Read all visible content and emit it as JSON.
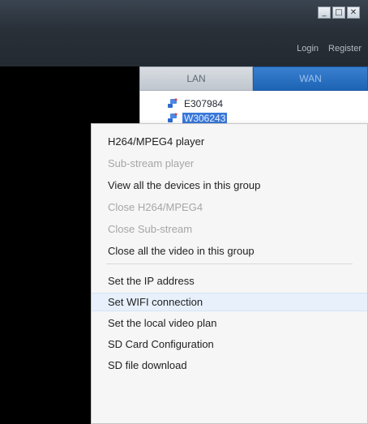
{
  "window": {
    "controls": {
      "minimize": "_",
      "restore": "□",
      "close": "✕"
    }
  },
  "toolbar": {
    "login_label": "Login",
    "register_label": "Register"
  },
  "tabs": [
    {
      "label": "LAN",
      "active": true
    },
    {
      "label": "WAN",
      "active": false
    }
  ],
  "devices": [
    {
      "name": "E307984",
      "selected": false
    },
    {
      "name": "W306243",
      "selected": true
    }
  ],
  "context_menu": {
    "items": [
      {
        "label": "H264/MPEG4 player",
        "disabled": false
      },
      {
        "label": "Sub-stream player",
        "disabled": true
      },
      {
        "label": "View all the devices in this group",
        "disabled": false
      },
      {
        "label": "Close H264/MPEG4",
        "disabled": true
      },
      {
        "label": "Close Sub-stream",
        "disabled": true
      },
      {
        "label": "Close all the video in this group",
        "disabled": false
      },
      {
        "label": "Set the IP address",
        "disabled": false
      },
      {
        "label": "Set WIFI connection",
        "disabled": false,
        "highlighted": true
      },
      {
        "label": "Set the local video plan",
        "disabled": false
      },
      {
        "label": "SD Card Configuration",
        "disabled": false
      },
      {
        "label": "SD file download",
        "disabled": false
      }
    ]
  },
  "colors": {
    "titlebar": "#2a313a",
    "wan_tab": "#1d64b5",
    "selection": "#3a78d8",
    "menu_highlight": "#e7f0fb"
  }
}
